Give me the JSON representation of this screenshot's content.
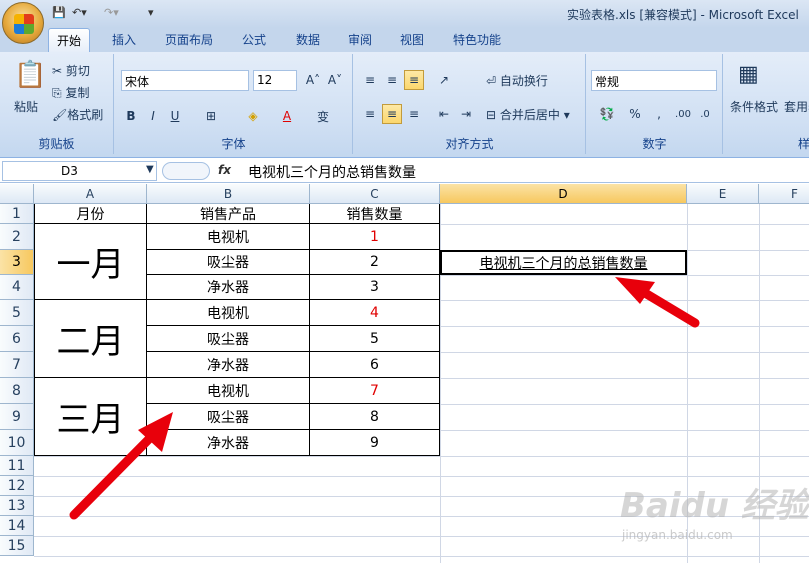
{
  "title": "实验表格.xls  [兼容模式] - Microsoft Excel",
  "tabs": [
    "开始",
    "插入",
    "页面布局",
    "公式",
    "数据",
    "审阅",
    "视图",
    "特色功能"
  ],
  "clipboard": {
    "paste": "粘贴",
    "cut": "剪切",
    "copy": "复制",
    "format_painter": "格式刷",
    "label": "剪贴板"
  },
  "font": {
    "name": "宋体",
    "size": "12",
    "label": "字体",
    "bold": "B",
    "italic": "I",
    "underline": "U"
  },
  "alignment": {
    "wrap": "自动换行",
    "merge": "合并后居中",
    "label": "对齐方式"
  },
  "number": {
    "format": "常规",
    "percent": "%",
    "comma": ",",
    "label": "数字"
  },
  "styles": {
    "conditional": "条件格式",
    "table": "套用表格",
    "label": "样"
  },
  "formula_bar": {
    "cell_ref": "D3",
    "fx": "fx",
    "content": "电视机三个月的总销售数量"
  },
  "columns": [
    "A",
    "B",
    "C",
    "D",
    "E",
    "F"
  ],
  "rows": [
    "1",
    "2",
    "3",
    "4",
    "5",
    "6",
    "7",
    "8",
    "9",
    "10",
    "11",
    "12",
    "13",
    "14",
    "15"
  ],
  "table": {
    "headers": [
      "月份",
      "销售产品",
      "销售数量"
    ],
    "months": [
      "一月",
      "二月",
      "三月"
    ],
    "products": [
      "电视机",
      "吸尘器",
      "净水器",
      "电视机",
      "吸尘器",
      "净水器",
      "电视机",
      "吸尘器",
      "净水器"
    ],
    "quantities": [
      "1",
      "2",
      "3",
      "4",
      "5",
      "6",
      "7",
      "8",
      "9"
    ]
  },
  "d3_value": "电视机三个月的总销售数量",
  "watermark": "Baidu 经验",
  "watermark_url": "jingyan.baidu.com",
  "colors": {
    "red": "#e00000",
    "arrow": "#e8000b"
  }
}
